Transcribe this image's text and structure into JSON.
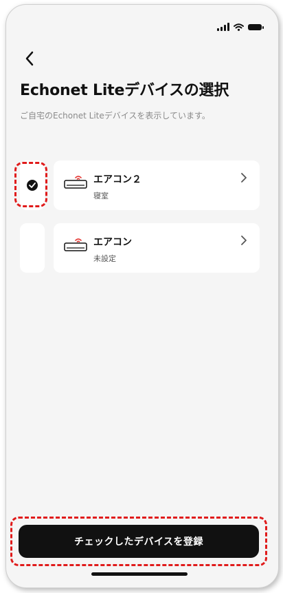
{
  "header": {
    "title": "Echonet Liteデバイスの選択",
    "subtitle": "ご自宅のEchonet Liteデバイスを表示しています。"
  },
  "devices": [
    {
      "name": "エアコン２",
      "room": "寝室",
      "checked": true,
      "icon": "air-conditioner-icon"
    },
    {
      "name": "エアコン",
      "room": "未設定",
      "checked": false,
      "icon": "air-conditioner-icon"
    }
  ],
  "footer": {
    "register_label": "チェックしたデバイスを登録"
  },
  "colors": {
    "accent": "#111111",
    "highlight": "#e01b1b",
    "wifi_signal": "#e53935"
  }
}
